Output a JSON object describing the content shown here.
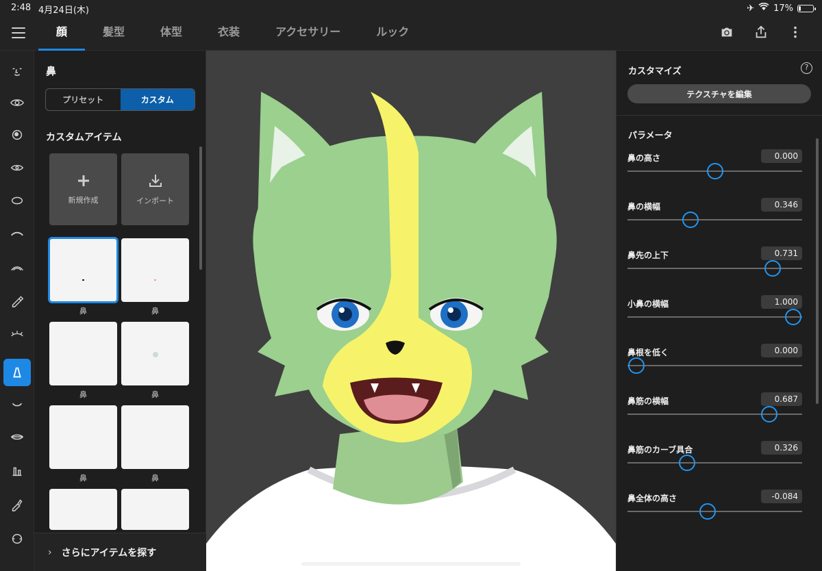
{
  "status": {
    "time": "2:48",
    "date": "4月24日(木)",
    "battery": "17%",
    "battery_level": 0.17
  },
  "tabs": [
    {
      "label": "顔",
      "active": true
    },
    {
      "label": "髪型"
    },
    {
      "label": "体型"
    },
    {
      "label": "衣装"
    },
    {
      "label": "アクセサリー"
    },
    {
      "label": "ルック"
    }
  ],
  "toolbar": {
    "camera": "camera-icon",
    "share": "share-icon",
    "more": "more-vert-icon"
  },
  "rail": [
    "face-icon",
    "eye-icon",
    "eyeball-icon",
    "eye-outline-icon",
    "face-contour-icon",
    "eyebrow-icon",
    "eyelid-icon",
    "eyeliner-icon",
    "eyelash-icon",
    "nose-icon",
    "mouth-icon",
    "lips-icon",
    "teeth-icon",
    "lipstick-icon",
    "ear-icon"
  ],
  "left_panel": {
    "title": "鼻",
    "segments": [
      "プリセット",
      "カスタム"
    ],
    "active_segment": "カスタム",
    "custom_title": "カスタムアイテム",
    "actions": [
      {
        "label": "新規作成",
        "icon": "plus-icon"
      },
      {
        "label": "インポート",
        "icon": "import-icon"
      }
    ],
    "items": [
      "鼻",
      "鼻",
      "鼻",
      "鼻",
      "鼻",
      "鼻",
      "",
      ""
    ],
    "more_label": "さらにアイテムを探す"
  },
  "right_panel": {
    "title": "カスタマイズ",
    "edit_texture": "テクスチャを編集",
    "param_title": "パラメータ",
    "params": [
      {
        "label": "鼻の高さ",
        "value": "0.000",
        "level": 0.5
      },
      {
        "label": "鼻の横幅",
        "value": "0.346",
        "level": 0.36
      },
      {
        "label": "鼻先の上下",
        "value": "0.731",
        "level": 0.83
      },
      {
        "label": "小鼻の横幅",
        "value": "1.000",
        "level": 0.95
      },
      {
        "label": "鼻根を低く",
        "value": "0.000",
        "level": 0.05
      },
      {
        "label": "鼻筋の横幅",
        "value": "0.687",
        "level": 0.81
      },
      {
        "label": "鼻筋のカーブ具合",
        "value": "0.326",
        "level": 0.34
      },
      {
        "label": "鼻全体の高さ",
        "value": "-0.084",
        "level": 0.46
      }
    ]
  },
  "colors": {
    "accent": "#1e88e5",
    "fur": "#9bd08f",
    "mask": "#f6f36a",
    "shirt": "#ffffff"
  }
}
